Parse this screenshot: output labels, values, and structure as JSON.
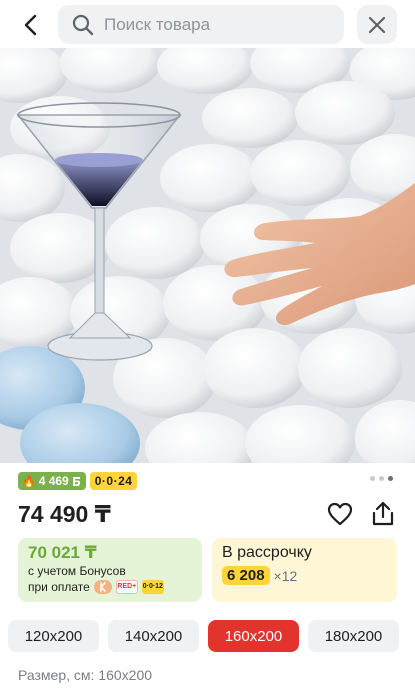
{
  "header": {
    "search_placeholder": "Поиск товара",
    "back_icon": "chevron-left-icon",
    "search_icon": "search-icon",
    "close_icon": "close-icon"
  },
  "gallery": {
    "image_description_icon": "product-photo",
    "page_count": 3,
    "active_page": 3
  },
  "badges": {
    "bonus_amount": "4 469",
    "bonus_icon": "flame-icon",
    "installment_label": "0·0·24"
  },
  "product": {
    "price": "74 490 ₸"
  },
  "bonus_card": {
    "price": "70 021 ₸",
    "line1": "с учетом Бонусов",
    "line2": "при оплате",
    "pay_methods": [
      "kaspi",
      "RED+",
      "0·0·12"
    ]
  },
  "installment_card": {
    "title": "В рассрочку",
    "amount": "6 208",
    "multiplier": "×12"
  },
  "sizes": {
    "options": [
      "120x200",
      "140x200",
      "160x200",
      "180x200"
    ],
    "selected_index": 2,
    "caption": "Размер, см: 160x200"
  },
  "colors": {
    "accent_red": "#e2332d",
    "bonus_green": "#7bb14a",
    "installment_yellow": "#ffd43b"
  }
}
